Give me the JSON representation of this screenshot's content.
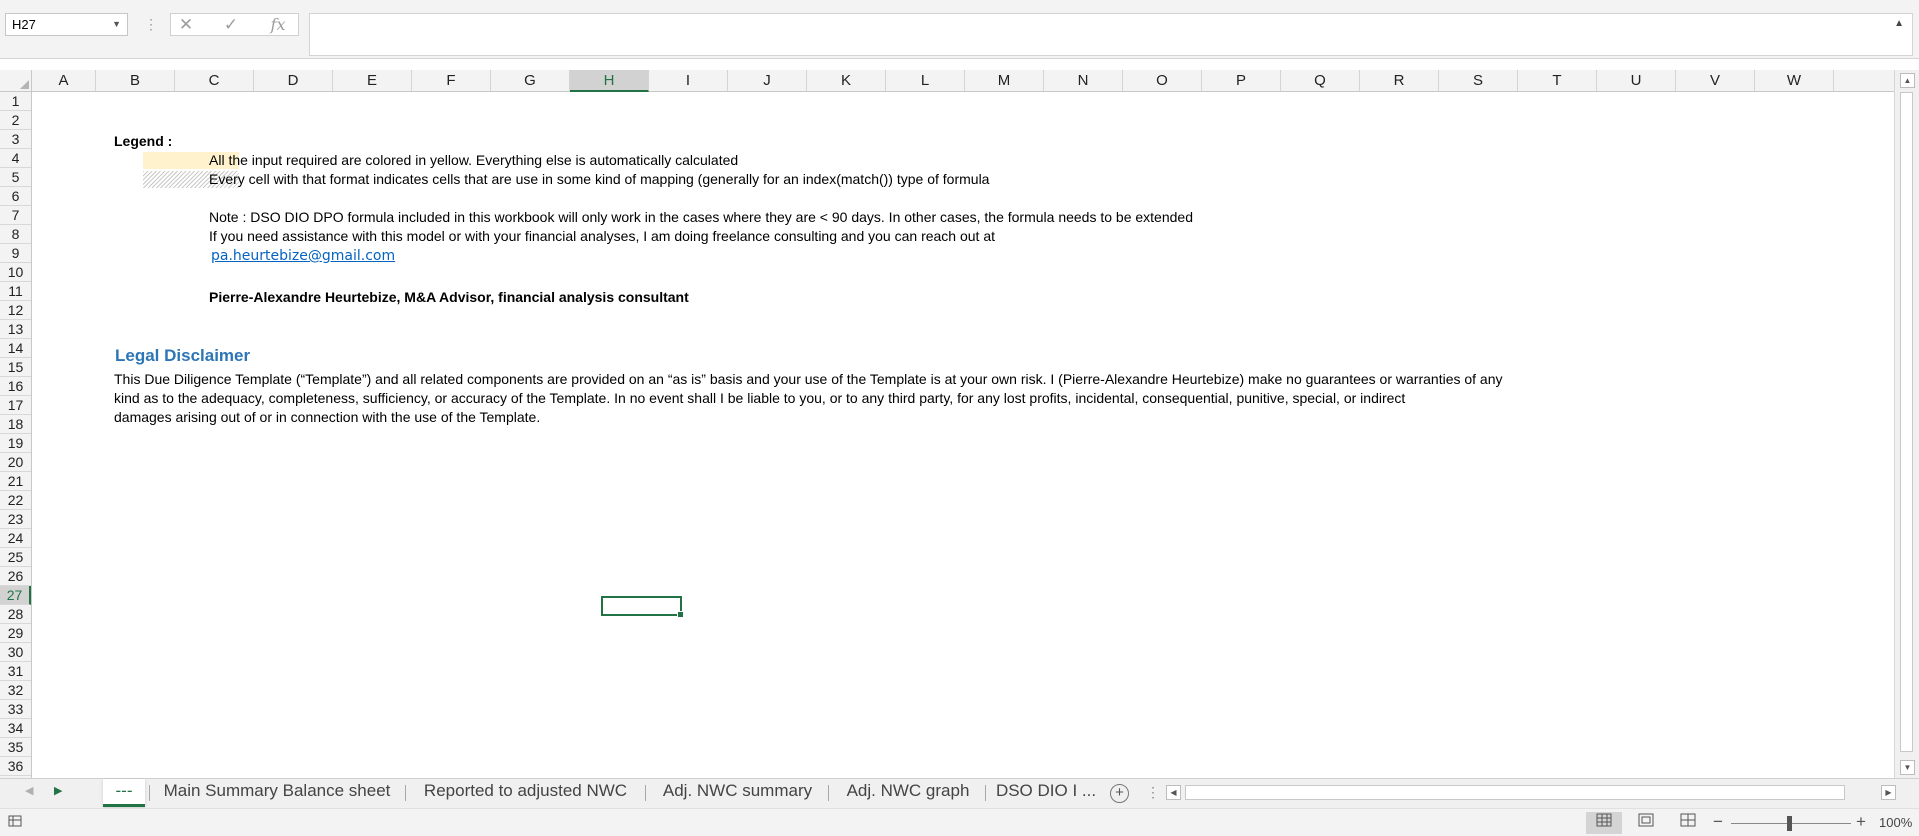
{
  "formula_bar": {
    "name_box": "H27",
    "cancel_icon": "✕",
    "enter_icon": "✓",
    "fx_label": "fx",
    "formula": ""
  },
  "columns": [
    "A",
    "B",
    "C",
    "D",
    "E",
    "F",
    "G",
    "H",
    "I",
    "J",
    "K",
    "L",
    "M",
    "N",
    "O",
    "P",
    "Q",
    "R",
    "S",
    "T",
    "U",
    "V",
    "W"
  ],
  "rows": [
    "1",
    "2",
    "3",
    "4",
    "5",
    "6",
    "7",
    "8",
    "9",
    "10",
    "11",
    "12",
    "13",
    "14",
    "15",
    "16",
    "17",
    "18",
    "19",
    "20",
    "21",
    "22",
    "23",
    "24",
    "25",
    "26",
    "27",
    "28",
    "29",
    "30",
    "31",
    "32",
    "33",
    "34",
    "35",
    "36"
  ],
  "selected_column": "H",
  "selected_row": "27",
  "cells": {
    "legend_label": "Legend :",
    "legend_yellow_text": "All the input required are colored in yellow. Everything else is automatically calculated",
    "legend_hatch_text": "Every cell with that format indicates cells that are use in some kind of mapping (generally for an index(match()) type of formula",
    "note_text": "Note : DSO DIO DPO formula included in this workbook will only work in the cases where they are < 90 days. In other cases, the formula needs to be extended",
    "assistance_text": "If you need assistance with this model or with your financial analyses, I am doing freelance consulting and you can reach out at",
    "email": "pa.heurtebize@gmail.com",
    "author": "Pierre-Alexandre Heurtebize, M&A Advisor, financial analysis consultant",
    "disclaimer_title": "Legal Disclaimer",
    "disclaimer_line1": "This Due Diligence Template (“Template”) and all related components are provided on an “as is” basis and your use of the Template is at your own risk.  I (Pierre-Alexandre Heurtebize) make no guarantees or warranties of any",
    "disclaimer_line2": "kind as to the adequacy, completeness, sufficiency, or accuracy of the Template. In no event shall I be liable to you, or to any third party, for any lost profits, incidental, consequential, punitive, special, or indirect",
    "disclaimer_line3": "damages arising out of or in connection with the use of the Template."
  },
  "colors": {
    "input_yellow": "#fff2cc",
    "accent_green": "#217346",
    "link_blue": "#0563c1",
    "heading_blue": "#2e75b6"
  },
  "sheet_tabs": [
    "---",
    "Main Summary Balance sheet",
    "Reported to adjusted NWC",
    "Adj. NWC summary",
    "Adj. NWC graph",
    "DSO DIO I ..."
  ],
  "active_tab": "---",
  "status_bar": {
    "zoom": "100%",
    "views": [
      "normal-view-icon",
      "page-layout-icon",
      "page-break-preview-icon"
    ]
  }
}
